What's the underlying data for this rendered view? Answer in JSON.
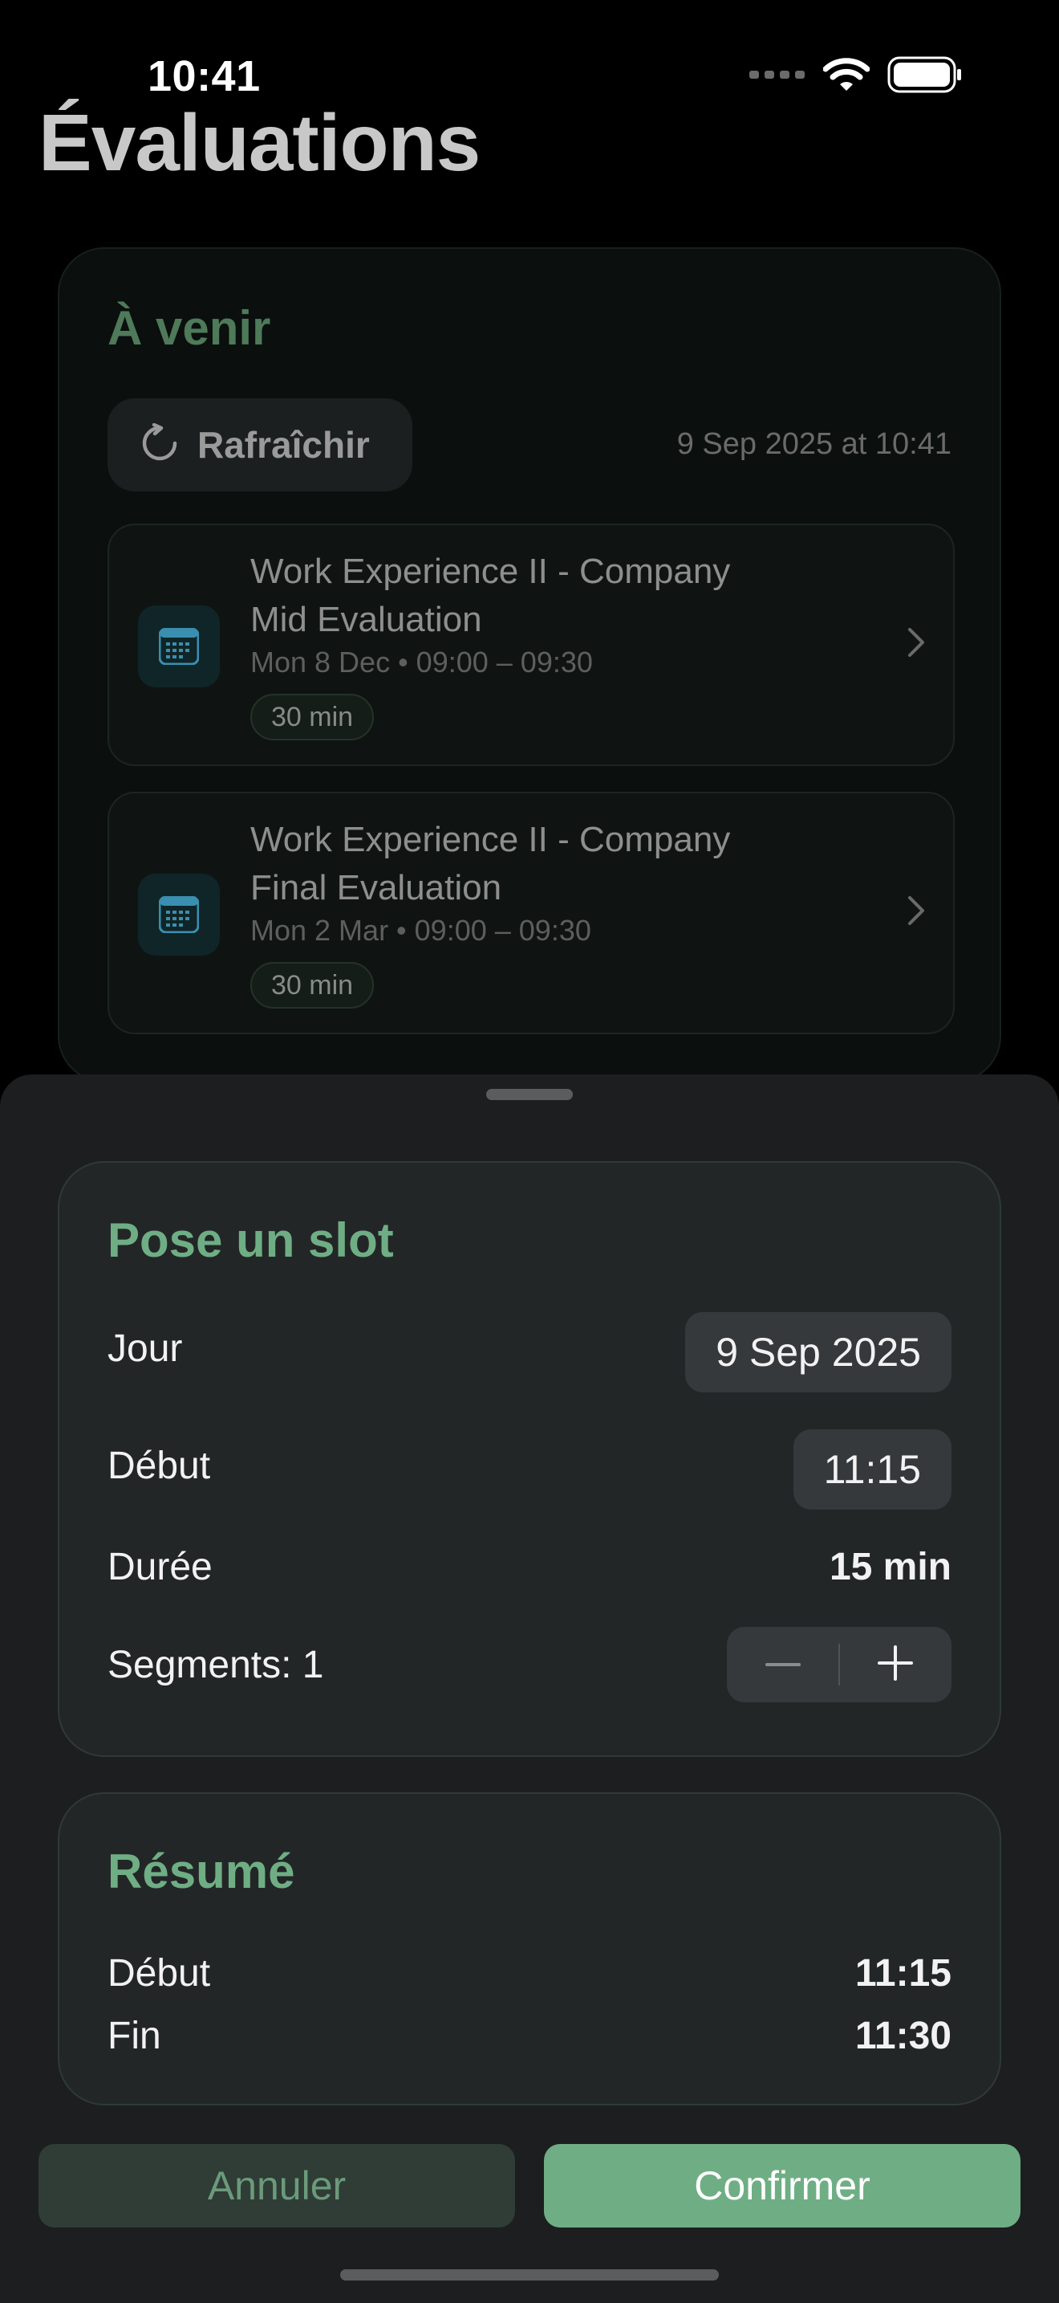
{
  "status_bar": {
    "time": "10:41"
  },
  "page": {
    "title": "Évaluations"
  },
  "upcoming": {
    "heading": "À venir",
    "refresh_label": "Rafraîchir",
    "last_updated": "9 Sep 2025 at 10:41",
    "items": [
      {
        "title_line1": "Work Experience II - Company",
        "title_line2": "Mid Evaluation",
        "meta": "Mon 8 Dec • 09:00 – 09:30",
        "duration": "30 min"
      },
      {
        "title_line1": "Work Experience II - Company",
        "title_line2": "Final Evaluation",
        "meta": "Mon 2 Mar • 09:00 – 09:30",
        "duration": "30 min"
      }
    ]
  },
  "slot_form": {
    "heading": "Pose un slot",
    "day_label": "Jour",
    "day_value": "9 Sep 2025",
    "start_label": "Début",
    "start_value": "11:15",
    "duration_label": "Durée",
    "duration_value": "15 min",
    "segments_label": "Segments: 1"
  },
  "summary": {
    "heading": "Résumé",
    "start_label": "Début",
    "start_value": "11:15",
    "end_label": "Fin",
    "end_value": "11:30"
  },
  "actions": {
    "cancel_label": "Annuler",
    "confirm_label": "Confirmer"
  },
  "colors": {
    "accent": "#6fae84",
    "accent_dim": "#4e7a5a",
    "calendar_icon": "#3a8fb0"
  },
  "icons": [
    "cellular-icon",
    "wifi-icon",
    "battery-icon",
    "refresh-icon",
    "calendar-icon",
    "chevron-right-icon",
    "minus-icon",
    "plus-icon"
  ]
}
